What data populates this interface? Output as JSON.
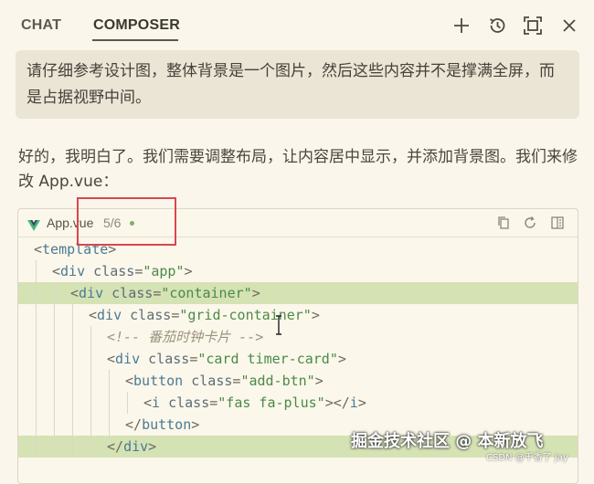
{
  "tabs": {
    "chat": "CHAT",
    "composer": "COMPOSER"
  },
  "toolbar_icons": [
    "plus-icon",
    "history-icon",
    "expand-icon",
    "close-icon"
  ],
  "user_message": "请仔细参考设计图，整体背景是一个图片，然后这些内容并不是撑满全屏，而是占据视野中间。",
  "assistant_message": "好的，我明白了。我们需要调整布局，让内容居中显示，并添加背景图。我们来修改 App.vue：",
  "code_block": {
    "filename": "App.vue",
    "change_count": "5/6",
    "actions": [
      "copy-icon",
      "refresh-icon",
      "diff-icon"
    ],
    "lines": [
      {
        "indent": 0,
        "highlight": false,
        "text": "<template>"
      },
      {
        "indent": 1,
        "highlight": false,
        "text": "<div class=\"app\">"
      },
      {
        "indent": 2,
        "highlight": true,
        "text": "<div class=\"container\">"
      },
      {
        "indent": 3,
        "highlight": false,
        "text": "<div class=\"grid-container\">"
      },
      {
        "indent": 4,
        "highlight": false,
        "text": "<!-- 番茄时钟卡片 -->"
      },
      {
        "indent": 4,
        "highlight": false,
        "text": "<div class=\"card timer-card\">"
      },
      {
        "indent": 5,
        "highlight": false,
        "text": "<button class=\"add-btn\">"
      },
      {
        "indent": 6,
        "highlight": false,
        "text": "<i class=\"fas fa-plus\"></i>"
      },
      {
        "indent": 5,
        "highlight": false,
        "text": "</button>"
      },
      {
        "indent": 4,
        "highlight": true,
        "text": "</div>"
      }
    ]
  },
  "watermark": {
    "main": "掘金技术社区 @ 本新放飞",
    "sub": "CSDN @千香了 jay"
  },
  "colors": {
    "background": "#faf6eb",
    "highlight_line": "#d5e2b4",
    "annotation": "#d7474f",
    "vue_green": "#42b883"
  }
}
